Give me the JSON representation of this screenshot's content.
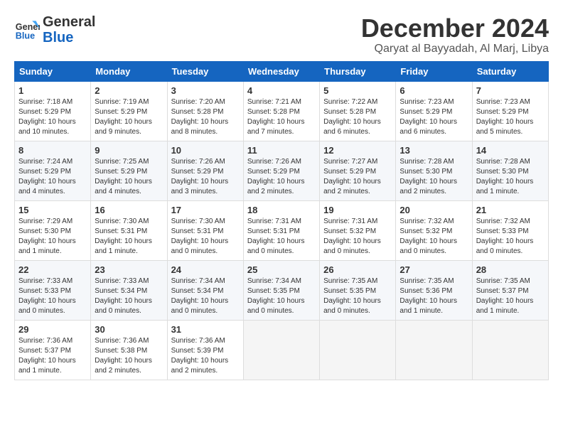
{
  "logo": {
    "general": "General",
    "blue": "Blue"
  },
  "header": {
    "month": "December 2024",
    "location": "Qaryat al Bayyadah, Al Marj, Libya"
  },
  "weekdays": [
    "Sunday",
    "Monday",
    "Tuesday",
    "Wednesday",
    "Thursday",
    "Friday",
    "Saturday"
  ],
  "weeks": [
    [
      {
        "day": "1",
        "info": "Sunrise: 7:18 AM\nSunset: 5:29 PM\nDaylight: 10 hours\nand 10 minutes."
      },
      {
        "day": "2",
        "info": "Sunrise: 7:19 AM\nSunset: 5:29 PM\nDaylight: 10 hours\nand 9 minutes."
      },
      {
        "day": "3",
        "info": "Sunrise: 7:20 AM\nSunset: 5:28 PM\nDaylight: 10 hours\nand 8 minutes."
      },
      {
        "day": "4",
        "info": "Sunrise: 7:21 AM\nSunset: 5:28 PM\nDaylight: 10 hours\nand 7 minutes."
      },
      {
        "day": "5",
        "info": "Sunrise: 7:22 AM\nSunset: 5:28 PM\nDaylight: 10 hours\nand 6 minutes."
      },
      {
        "day": "6",
        "info": "Sunrise: 7:23 AM\nSunset: 5:29 PM\nDaylight: 10 hours\nand 6 minutes."
      },
      {
        "day": "7",
        "info": "Sunrise: 7:23 AM\nSunset: 5:29 PM\nDaylight: 10 hours\nand 5 minutes."
      }
    ],
    [
      {
        "day": "8",
        "info": "Sunrise: 7:24 AM\nSunset: 5:29 PM\nDaylight: 10 hours\nand 4 minutes."
      },
      {
        "day": "9",
        "info": "Sunrise: 7:25 AM\nSunset: 5:29 PM\nDaylight: 10 hours\nand 4 minutes."
      },
      {
        "day": "10",
        "info": "Sunrise: 7:26 AM\nSunset: 5:29 PM\nDaylight: 10 hours\nand 3 minutes."
      },
      {
        "day": "11",
        "info": "Sunrise: 7:26 AM\nSunset: 5:29 PM\nDaylight: 10 hours\nand 2 minutes."
      },
      {
        "day": "12",
        "info": "Sunrise: 7:27 AM\nSunset: 5:29 PM\nDaylight: 10 hours\nand 2 minutes."
      },
      {
        "day": "13",
        "info": "Sunrise: 7:28 AM\nSunset: 5:30 PM\nDaylight: 10 hours\nand 2 minutes."
      },
      {
        "day": "14",
        "info": "Sunrise: 7:28 AM\nSunset: 5:30 PM\nDaylight: 10 hours\nand 1 minute."
      }
    ],
    [
      {
        "day": "15",
        "info": "Sunrise: 7:29 AM\nSunset: 5:30 PM\nDaylight: 10 hours\nand 1 minute."
      },
      {
        "day": "16",
        "info": "Sunrise: 7:30 AM\nSunset: 5:31 PM\nDaylight: 10 hours\nand 1 minute."
      },
      {
        "day": "17",
        "info": "Sunrise: 7:30 AM\nSunset: 5:31 PM\nDaylight: 10 hours\nand 0 minutes."
      },
      {
        "day": "18",
        "info": "Sunrise: 7:31 AM\nSunset: 5:31 PM\nDaylight: 10 hours\nand 0 minutes."
      },
      {
        "day": "19",
        "info": "Sunrise: 7:31 AM\nSunset: 5:32 PM\nDaylight: 10 hours\nand 0 minutes."
      },
      {
        "day": "20",
        "info": "Sunrise: 7:32 AM\nSunset: 5:32 PM\nDaylight: 10 hours\nand 0 minutes."
      },
      {
        "day": "21",
        "info": "Sunrise: 7:32 AM\nSunset: 5:33 PM\nDaylight: 10 hours\nand 0 minutes."
      }
    ],
    [
      {
        "day": "22",
        "info": "Sunrise: 7:33 AM\nSunset: 5:33 PM\nDaylight: 10 hours\nand 0 minutes."
      },
      {
        "day": "23",
        "info": "Sunrise: 7:33 AM\nSunset: 5:34 PM\nDaylight: 10 hours\nand 0 minutes."
      },
      {
        "day": "24",
        "info": "Sunrise: 7:34 AM\nSunset: 5:34 PM\nDaylight: 10 hours\nand 0 minutes."
      },
      {
        "day": "25",
        "info": "Sunrise: 7:34 AM\nSunset: 5:35 PM\nDaylight: 10 hours\nand 0 minutes."
      },
      {
        "day": "26",
        "info": "Sunrise: 7:35 AM\nSunset: 5:35 PM\nDaylight: 10 hours\nand 0 minutes."
      },
      {
        "day": "27",
        "info": "Sunrise: 7:35 AM\nSunset: 5:36 PM\nDaylight: 10 hours\nand 1 minute."
      },
      {
        "day": "28",
        "info": "Sunrise: 7:35 AM\nSunset: 5:37 PM\nDaylight: 10 hours\nand 1 minute."
      }
    ],
    [
      {
        "day": "29",
        "info": "Sunrise: 7:36 AM\nSunset: 5:37 PM\nDaylight: 10 hours\nand 1 minute."
      },
      {
        "day": "30",
        "info": "Sunrise: 7:36 AM\nSunset: 5:38 PM\nDaylight: 10 hours\nand 2 minutes."
      },
      {
        "day": "31",
        "info": "Sunrise: 7:36 AM\nSunset: 5:39 PM\nDaylight: 10 hours\nand 2 minutes."
      },
      {
        "day": "",
        "info": ""
      },
      {
        "day": "",
        "info": ""
      },
      {
        "day": "",
        "info": ""
      },
      {
        "day": "",
        "info": ""
      }
    ]
  ]
}
